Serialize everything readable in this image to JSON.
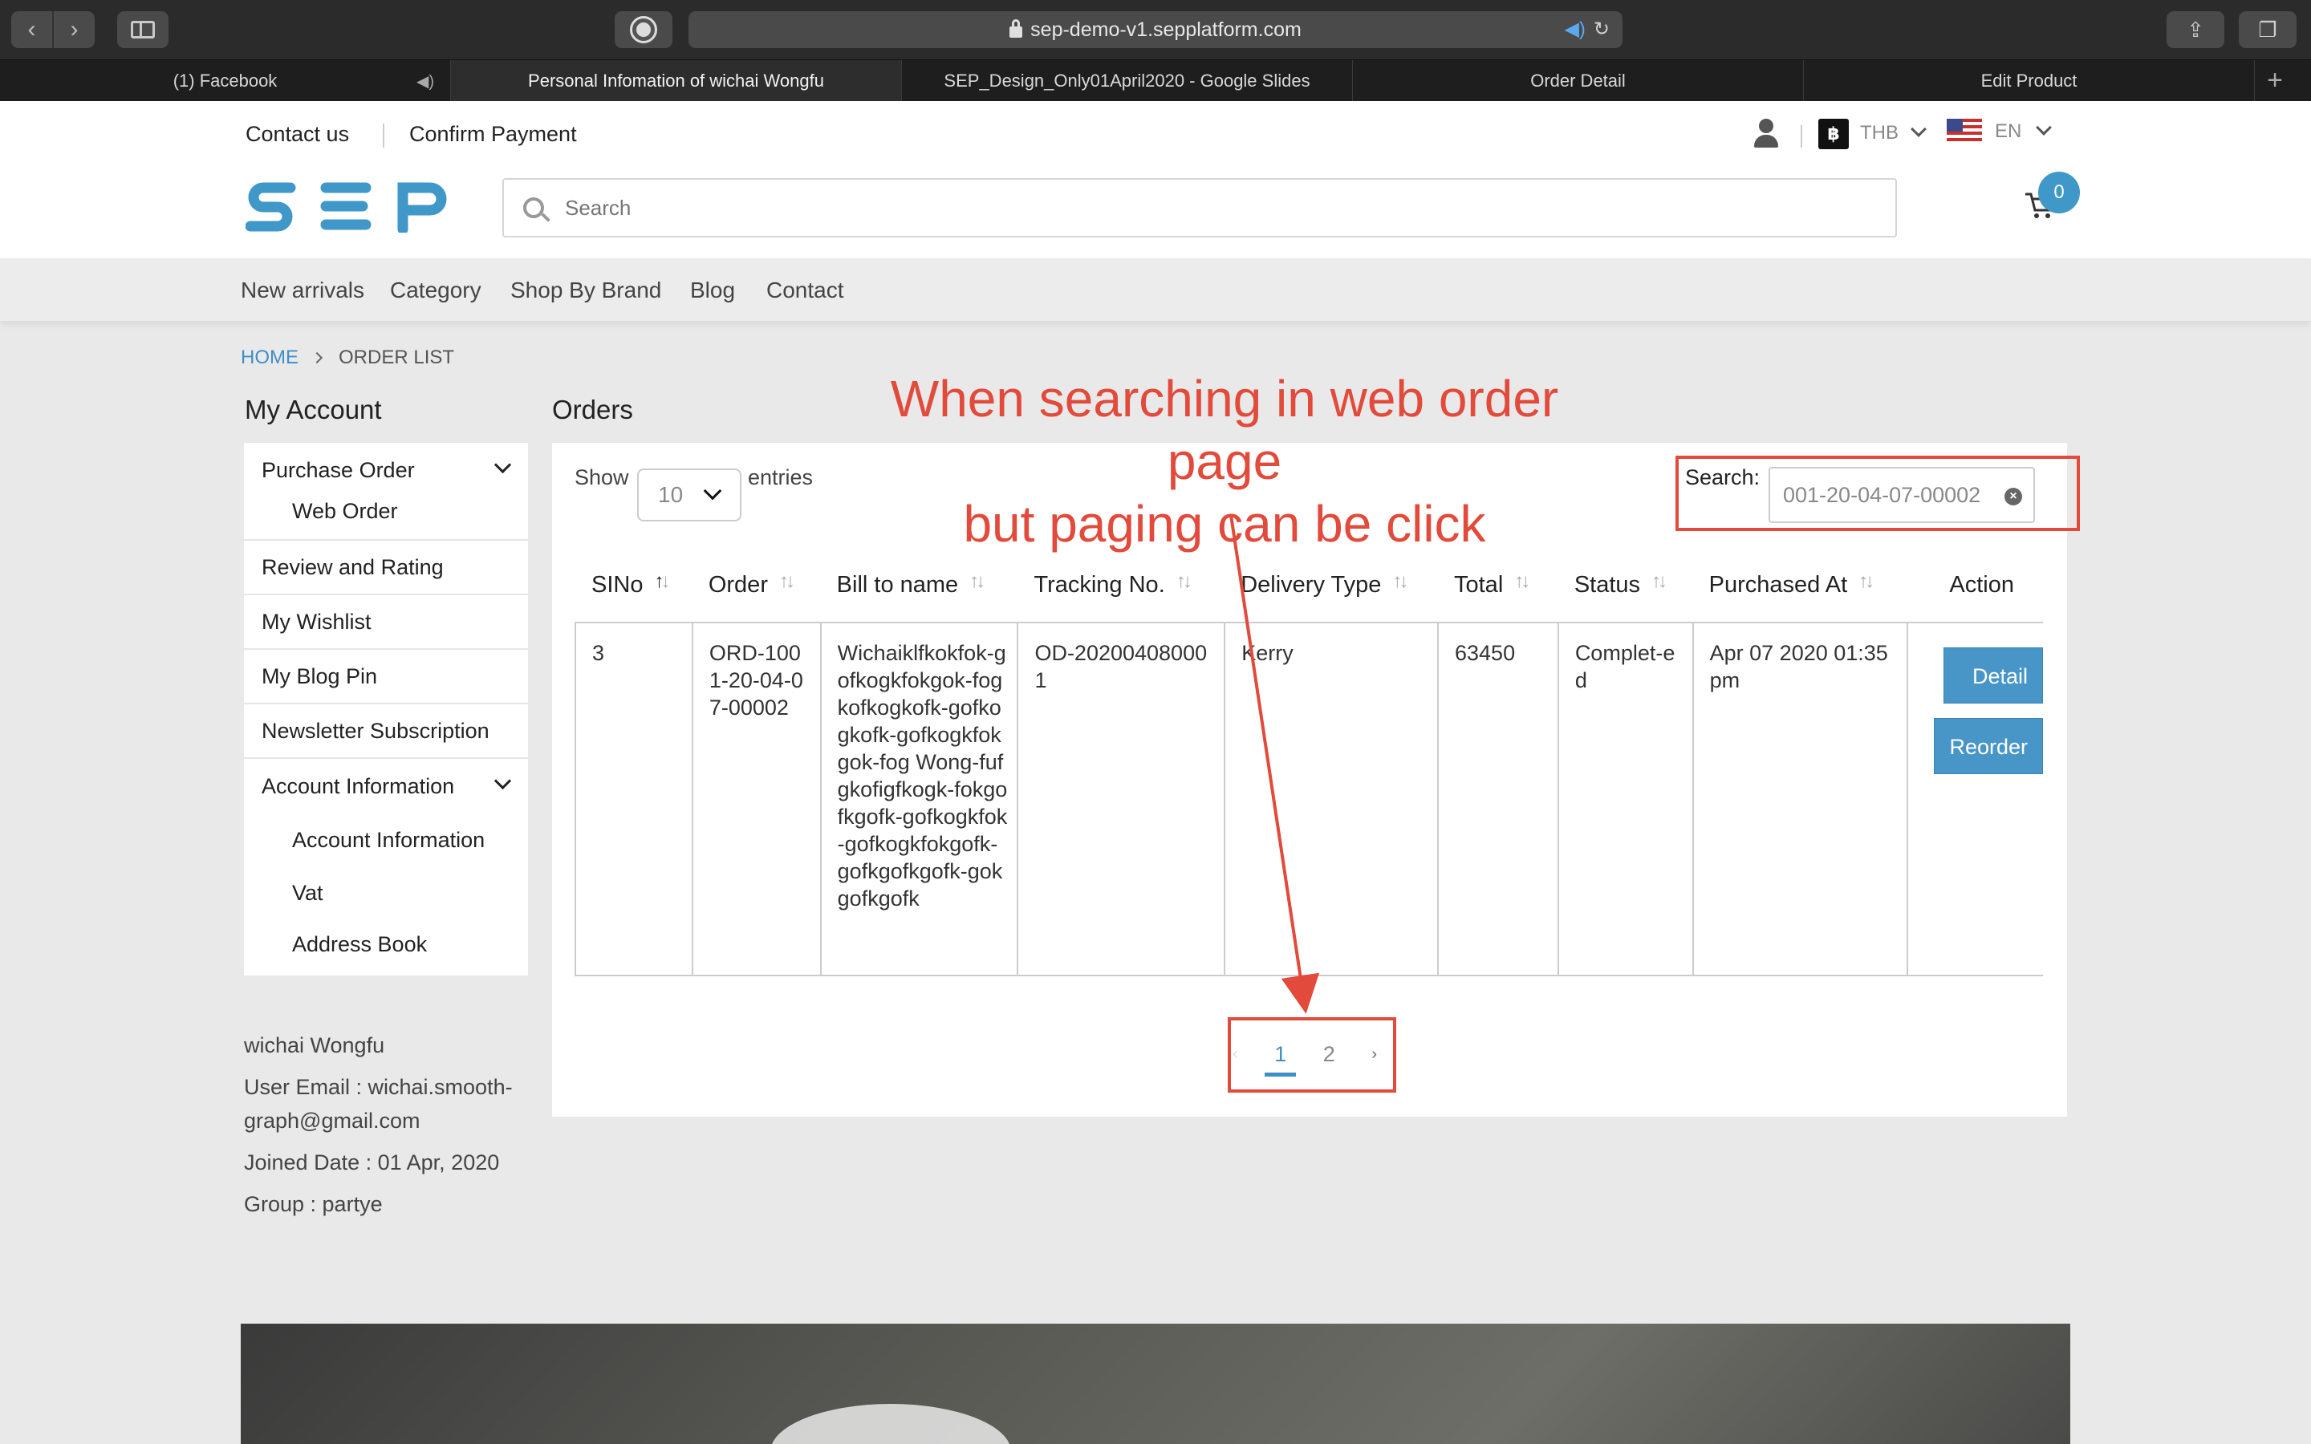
{
  "browser": {
    "url": "sep-demo-v1.sepplatform.com",
    "tabs": [
      {
        "label": "(1) Facebook",
        "active": false
      },
      {
        "label": "Personal Infomation of wichai Wongfu",
        "active": true
      },
      {
        "label": "SEP_Design_Only01April2020 - Google Slides",
        "active": false
      },
      {
        "label": "Order Detail",
        "active": false
      },
      {
        "label": "Edit Product",
        "active": false
      }
    ]
  },
  "header": {
    "contact": "Contact us",
    "confirm_payment": "Confirm Payment",
    "currency": "THB",
    "currency_symbol": "฿",
    "language": "EN",
    "search_placeholder": "Search",
    "cart_count": "0",
    "logo_text": "SEP",
    "brand_color": "#3f98c8"
  },
  "menu": {
    "new_arrivals": "New arrivals",
    "category": "Category",
    "shop_by_brand": "Shop By Brand",
    "blog": "Blog",
    "contact": "Contact"
  },
  "breadcrumb": {
    "home": "HOME",
    "current": "ORDER LIST"
  },
  "account": {
    "title": "My Account",
    "purchase_order": "Purchase Order",
    "web_order": "Web Order",
    "review": "Review and Rating",
    "wishlist": "My Wishlist",
    "blog_pin": "My Blog Pin",
    "newsletter": "Newsletter Subscription",
    "account_info": "Account Information",
    "account_info_sub": "Account Information",
    "vat": "Vat",
    "address_book": "Address Book"
  },
  "profile": {
    "name": "wichai Wongfu",
    "email": "User Email : wichai.smooth-graph@gmail.com",
    "joined": "Joined Date : 01 Apr, 2020",
    "group": "Group : partye"
  },
  "orders": {
    "title": "Orders",
    "show": "Show",
    "page_size": "10",
    "entries": "entries",
    "search_label": "Search:",
    "search_value": "001-20-04-07-00002",
    "columns": [
      "SINo",
      "Order",
      "Bill to name",
      "Tracking No.",
      "Delivery Type",
      "Total",
      "Status",
      "Purchased At",
      "Action"
    ],
    "rows": [
      {
        "sino": "3",
        "order": "ORD-1001-20-04-07-00002",
        "bill_to": "Wichaiklfkokfok-gofkogkfokgok-fogkofkogkofk-gofkogkofk-gofkogkfokgok-fog Wong-fufgkofigfkogk-fokgofkgofk-gofkogkfok-gofkogkfokgofk-gofkgofkgofk-gokgofkgofk",
        "tracking": "OD-202004080001",
        "delivery": "Kerry",
        "total": "63450",
        "status": "Complet-ed",
        "purchased": "Apr 07 2020 01:35 pm",
        "detail": "Detail",
        "reorder": "Reorder"
      }
    ],
    "pages": [
      "1",
      "2"
    ],
    "prev": "‹",
    "next": "›"
  },
  "annotation": {
    "line1": "When searching in web order page",
    "line2": "but paging can be click",
    "color": "#e24a3b"
  }
}
